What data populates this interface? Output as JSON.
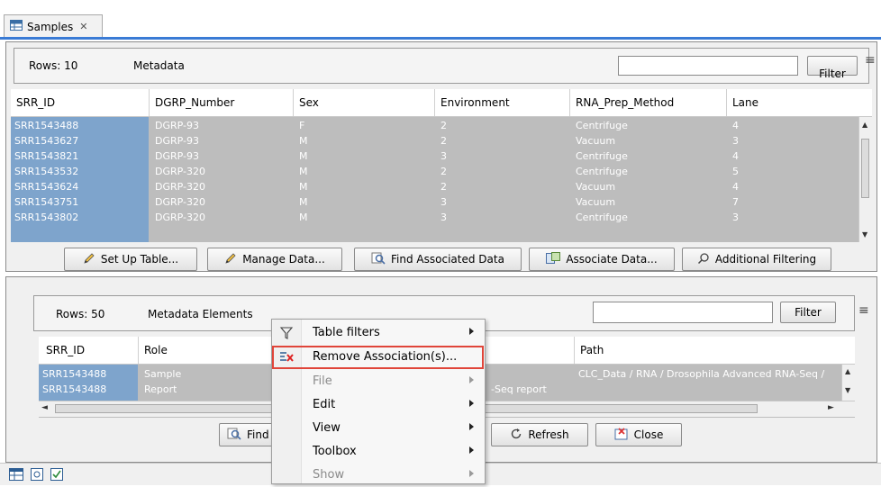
{
  "tab": {
    "title": "Samples",
    "close": "✕"
  },
  "top": {
    "rows_label": "Rows: 10",
    "metadata_label": "Metadata",
    "filter_button": "Filter",
    "filter_value": "",
    "columns": [
      "SRR_ID",
      "DGRP_Number",
      "Sex",
      "Environment",
      "RNA_Prep_Method",
      "Lane"
    ],
    "rows": [
      [
        "SRR1543488",
        "DGRP-93",
        "F",
        "2",
        "Centrifuge",
        "4"
      ],
      [
        "SRR1543627",
        "DGRP-93",
        "M",
        "2",
        "Vacuum",
        "3"
      ],
      [
        "SRR1543821",
        "DGRP-93",
        "M",
        "3",
        "Centrifuge",
        "4"
      ],
      [
        "SRR1543532",
        "DGRP-320",
        "M",
        "2",
        "Centrifuge",
        "5"
      ],
      [
        "SRR1543624",
        "DGRP-320",
        "M",
        "2",
        "Vacuum",
        "4"
      ],
      [
        "SRR1543751",
        "DGRP-320",
        "M",
        "3",
        "Vacuum",
        "7"
      ],
      [
        "SRR1543802",
        "DGRP-320",
        "M",
        "3",
        "Centrifuge",
        "3"
      ]
    ],
    "buttons": {
      "setup": "Set Up Table...",
      "manage": "Manage Data...",
      "find": "Find Associated Data",
      "associate": "Associate Data...",
      "filtering": "Additional Filtering"
    }
  },
  "bottom": {
    "rows_label": "Rows: 50",
    "metadata_label": "Metadata Elements",
    "filter_button": "Filter",
    "filter_value": "",
    "columns": [
      "SRR_ID",
      "Role",
      "Path"
    ],
    "rows": [
      [
        "SRR1543488",
        "Sample",
        "CLC_Data / RNA / Drosophila Advanced RNA-Seq /"
      ],
      [
        "SRR1543488",
        "Report",
        ""
      ]
    ],
    "row2_partial": "-Seq report",
    "buttons": {
      "find": "Find",
      "refresh": "Refresh",
      "close": "Close"
    }
  },
  "context_menu": {
    "items": [
      {
        "label": "Table filters",
        "submenu": true,
        "disabled": false,
        "icon": "filter-icon"
      },
      {
        "label": "Remove Association(s)...",
        "submenu": false,
        "disabled": false,
        "icon": "remove-association-icon",
        "highlighted": true
      },
      {
        "label": "File",
        "submenu": true,
        "disabled": true
      },
      {
        "label": "Edit",
        "submenu": true,
        "disabled": false
      },
      {
        "label": "View",
        "submenu": true,
        "disabled": false
      },
      {
        "label": "Toolbox",
        "submenu": true,
        "disabled": false
      },
      {
        "label": "Show",
        "submenu": true,
        "disabled": true
      }
    ],
    "highlight_color": "#e0453a"
  },
  "colors": {
    "tab_accent": "#3a7bd5",
    "selection_blue": "#7ea4cc",
    "row_gray": "#bdbdbd"
  }
}
